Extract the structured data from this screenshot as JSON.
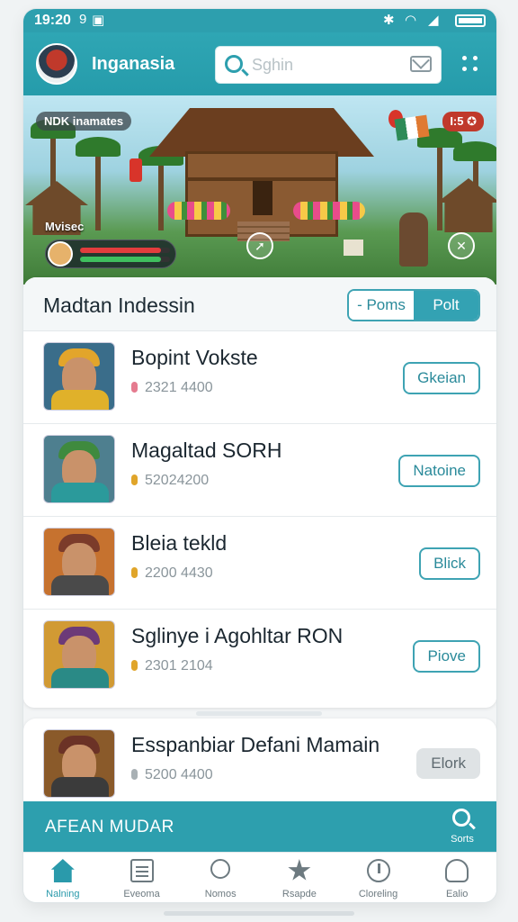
{
  "status_bar": {
    "time": "19:20",
    "icon_left_1": "9",
    "icon_left_2": "▣"
  },
  "header": {
    "title": "Inganasia",
    "search": {
      "placeholder": "Sghin",
      "value": ""
    },
    "icons": [
      "avatar",
      "search-icon",
      "mail-icon",
      "menu-dots-icon"
    ]
  },
  "banner": {
    "tag": "NDK inamates",
    "badge": "I:5 ✪",
    "player_label": "Mvisec",
    "hp": 0.9,
    "mp": 0.9
  },
  "panel": {
    "title": "Madtan Indessin",
    "toggle": {
      "option_a": "- Poms",
      "option_b": "Polt"
    }
  },
  "list": [
    {
      "name": "Bopint Vokste",
      "meta": "2321 4400",
      "action": "Gkeian",
      "drop_color": "#e57b8f",
      "hat_color": "#e2a52b",
      "scarf_color": "#e0b12a",
      "bg": "#3a6d8a"
    },
    {
      "name": "Magaltad SORH",
      "meta": "52024200",
      "action": "Natoine",
      "drop_color": "#e0a52a",
      "hat_color": "#3f8a3e",
      "scarf_color": "#2b9a9b",
      "bg": "#4e7f8f"
    },
    {
      "name": "Bleia tekld",
      "meta": "2200 4430",
      "action": "Blick",
      "drop_color": "#e0a52a",
      "hat_color": "#7b3b2a",
      "scarf_color": "#4a4a4a",
      "bg": "#c6722f"
    },
    {
      "name": "Sglinye i Agohltar RON",
      "meta": "2301 2104",
      "action": "Piove",
      "drop_color": "#e0a52a",
      "hat_color": "#6c3a78",
      "scarf_color": "#2a8a86",
      "bg": "#d19a34"
    }
  ],
  "extra_item": {
    "name": "Esspanbiar Defani Mamain",
    "meta": "5200 4400",
    "action": "Elork",
    "drop_color": "#a8b0b4"
  },
  "promo": {
    "text": "AFEAN MUDAR",
    "search_label": "Sorts"
  },
  "nav": [
    {
      "label": "Nalning",
      "icon": "home-icon",
      "active": true
    },
    {
      "label": "Eveoma",
      "icon": "document-icon",
      "active": false
    },
    {
      "label": "Nomos",
      "icon": "search-icon",
      "active": false
    },
    {
      "label": "Rsapde",
      "icon": "star-icon",
      "active": false
    },
    {
      "label": "Cloreling",
      "icon": "clock-icon",
      "active": false
    },
    {
      "label": "Ealio",
      "icon": "user-icon",
      "active": false
    }
  ],
  "colors": {
    "accent": "#2d9fae",
    "accent_dark": "#249aa9",
    "text": "#1f2a33",
    "muted": "#8a959b"
  }
}
